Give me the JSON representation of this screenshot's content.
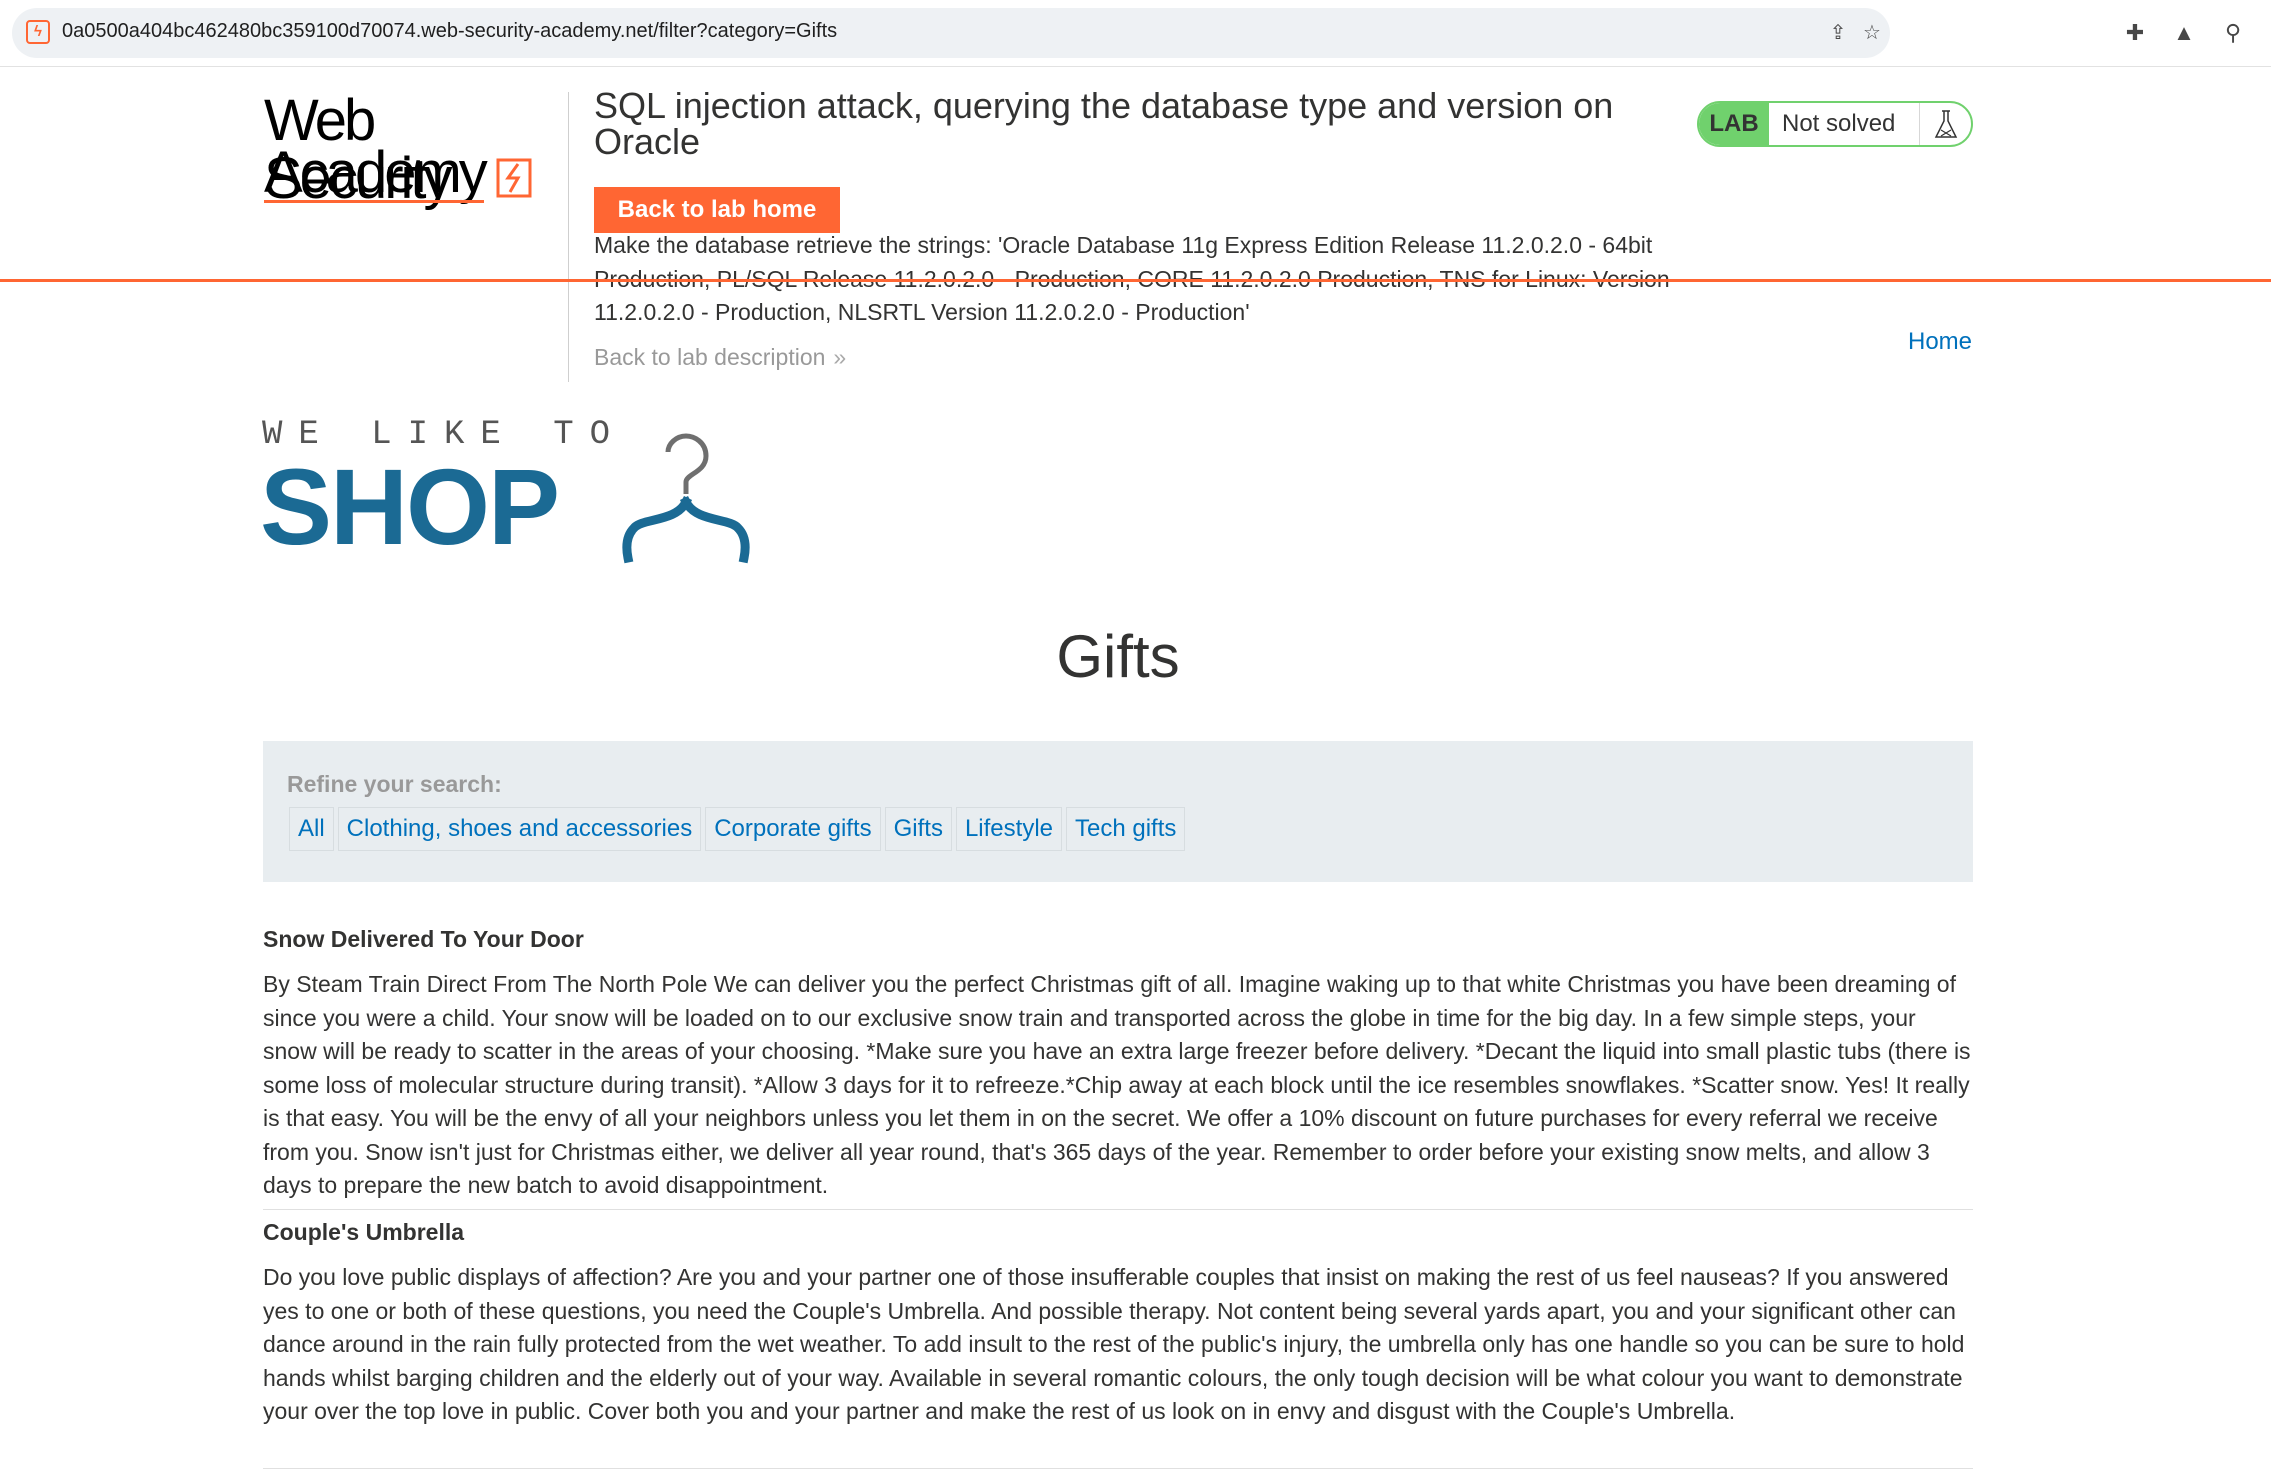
{
  "browser": {
    "url": "0a0500a404bc462480bc359100d70074.web-security-academy.net/filter?category=Gifts"
  },
  "academy": {
    "logo_line1": "Web Security",
    "logo_line2": "Academy",
    "lab_title": "SQL injection attack, querying the database type and version on Oracle",
    "back_home_label": "Back to lab home",
    "description": "Make the database retrieve the strings: 'Oracle Database 11g Express Edition Release 11.2.0.2.0 - 64bit Production, PL/SQL Release 11.2.0.2.0 - Production, CORE 11.2.0.2.0 Production, TNS for Linux: Version 11.2.0.2.0 - Production, NLSRTL Version 11.2.0.2.0 - Production'",
    "back_desc_label": "Back to lab description",
    "status_badge": "LAB",
    "status_text": "Not solved",
    "home_link": "Home"
  },
  "shop": {
    "tagline": "WE LIKE TO",
    "word": "SHOP"
  },
  "page": {
    "heading": "Gifts"
  },
  "filters": {
    "label": "Refine your search:",
    "categories": [
      "All",
      "Clothing, shoes and accessories",
      "Corporate gifts",
      "Gifts",
      "Lifestyle",
      "Tech gifts"
    ]
  },
  "products": [
    {
      "name": "Snow Delivered To Your Door",
      "description": "By Steam Train Direct From The North Pole We can deliver you the perfect Christmas gift of all. Imagine waking up to that white Christmas you have been dreaming of since you were a child. Your snow will be loaded on to our exclusive snow train and transported across the globe in time for the big day. In a few simple steps, your snow will be ready to scatter in the areas of your choosing. *Make sure you have an extra large freezer before delivery. *Decant the liquid into small plastic tubs (there is some loss of molecular structure during transit). *Allow 3 days for it to refreeze.*Chip away at each block until the ice resembles snowflakes. *Scatter snow. Yes! It really is that easy. You will be the envy of all your neighbors unless you let them in on the secret. We offer a 10% discount on future purchases for every referral we receive from you. Snow isn't just for Christmas either, we deliver all year round, that's 365 days of the year. Remember to order before your existing snow melts, and allow 3 days to prepare the new batch to avoid disappointment."
    },
    {
      "name": "Couple's Umbrella",
      "description": "Do you love public displays of affection? Are you and your partner one of those insufferable couples that insist on making the rest of us feel nauseas? If you answered yes to one or both of these questions, you need the Couple's Umbrella. And possible therapy. Not content being several yards apart, you and your significant other can dance around in the rain fully protected from the wet weather. To add insult to the rest of the public's injury, the umbrella only has one handle so you can be sure to hold hands whilst barging children and the elderly out of your way. Available in several romantic colours, the only tough decision will be what colour you want to demonstrate your over the top love in public. Cover both you and your partner and make the rest of us look on in envy and disgust with the Couple's Umbrella."
    }
  ],
  "colors": {
    "accent_orange": "#ff6633",
    "shop_blue": "#1b6a94",
    "link_blue": "#0071bc",
    "lab_green": "#70d16d"
  },
  "icons": {
    "site": "lightning-favicon-icon",
    "share": "share-icon",
    "star": "bookmark-star-icon",
    "extensions": "puzzle-icon",
    "labs": "flask-icon",
    "search": "search-icon",
    "status": "flask-icon",
    "hanger": "hanger-icon",
    "back_desc": "double-chevron-right-icon"
  }
}
